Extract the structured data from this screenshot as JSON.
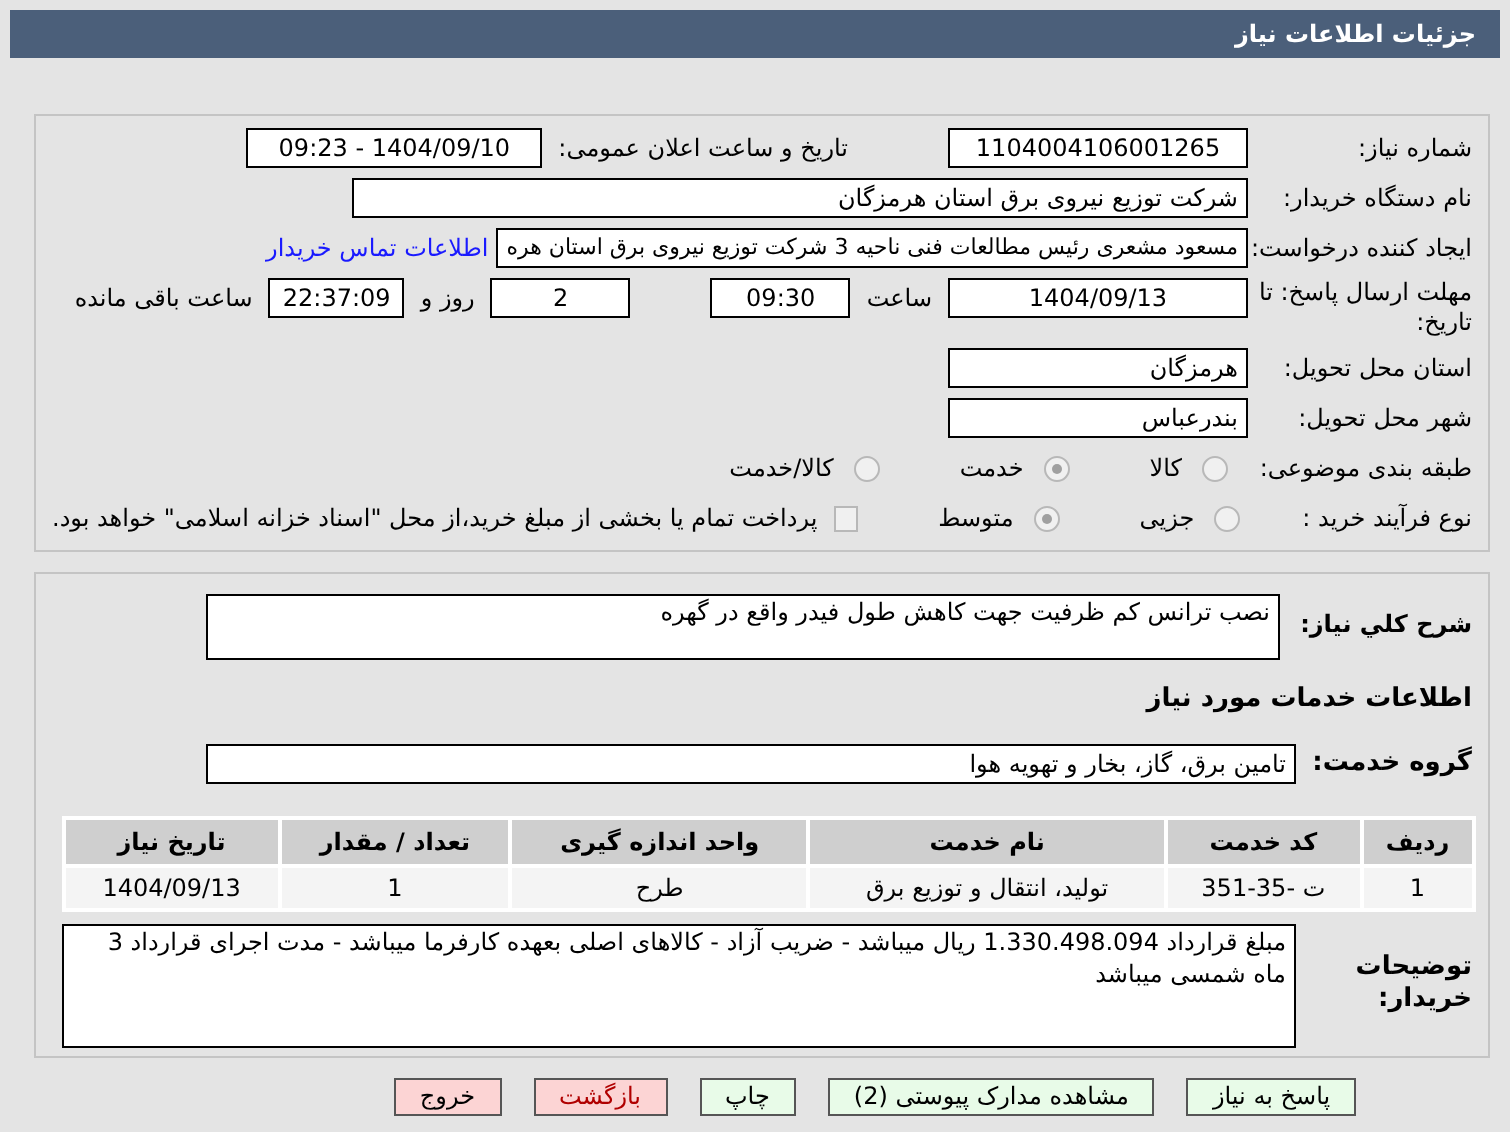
{
  "title": "جزئیات اطلاعات نیاز",
  "need_number": {
    "label": "شماره نیاز:",
    "value": "1104004106001265"
  },
  "announce": {
    "label": "تاریخ و ساعت اعلان عمومی:",
    "value": "1404/09/10 - 09:23"
  },
  "buyer": {
    "label": "نام دستگاه خریدار:",
    "value": "شرکت توزیع نیروی برق استان هرمزگان"
  },
  "creator": {
    "label": "ایجاد کننده درخواست:",
    "value": "مسعود مشعری رئیس مطالعات فنی ناحیه 3 شرکت توزیع نیروی برق استان هره",
    "link": "اطلاعات تماس خریدار"
  },
  "deadline": {
    "label": "مهلت ارسال پاسخ: تا تاریخ:",
    "date": "1404/09/13",
    "time_label": "ساعت",
    "time": "09:30",
    "days": "2",
    "days_label": "روز و",
    "remaining": "22:37:09",
    "remaining_label": "ساعت باقی مانده"
  },
  "province": {
    "label": "استان محل تحویل:",
    "value": "هرمزگان"
  },
  "city": {
    "label": "شهر محل تحویل:",
    "value": "بندرعباس"
  },
  "category": {
    "label": "طبقه بندی موضوعی:",
    "options": [
      {
        "label": "کالا",
        "selected": false
      },
      {
        "label": "خدمت",
        "selected": true
      },
      {
        "label": "کالا/خدمت",
        "selected": false
      }
    ]
  },
  "process": {
    "label": "نوع فرآیند خرید :",
    "options": [
      {
        "label": "جزیی",
        "selected": false
      },
      {
        "label": "متوسط",
        "selected": true
      }
    ],
    "payment": {
      "checked": false,
      "text": "پرداخت تمام یا بخشی از مبلغ خرید،از محل \"اسناد خزانه اسلامی\" خواهد بود."
    }
  },
  "summary": {
    "label": "شرح كلي نياز:",
    "value": "نصب ترانس کم ظرفیت جهت کاهش طول فیدر واقع در گهره"
  },
  "services_heading": "اطلاعات خدمات مورد نیاز",
  "service_group": {
    "label": "گروه خدمت:",
    "value": "تامین برق، گاز، بخار و تهویه هوا"
  },
  "table": {
    "columns": [
      "ردیف",
      "کد خدمت",
      "نام خدمت",
      "واحد اندازه گیری",
      "تعداد / مقدار",
      "تاریخ نیاز"
    ],
    "rows": [
      [
        "1",
        "ت -35-351",
        "تولید، انتقال و توزیع برق",
        "طرح",
        "1",
        "1404/09/13"
      ]
    ]
  },
  "buyer_notes": {
    "label": "توضیحات خریدار:",
    "value": "مبلغ قرارداد 1.330.498.094 ریال میباشد - ضریب آزاد - کالاهای اصلی بعهده کارفرما میباشد - مدت اجرای قرارداد 3 ماه شمسی میباشد"
  },
  "buttons": [
    {
      "label": "پاسخ به نیاز",
      "kind": "normal"
    },
    {
      "label": "مشاهده مدارک پیوستی (2)",
      "kind": "normal"
    },
    {
      "label": "چاپ",
      "kind": "normal"
    },
    {
      "label": "بازگشت",
      "kind": "back"
    },
    {
      "label": "خروج",
      "kind": "exit"
    }
  ]
}
